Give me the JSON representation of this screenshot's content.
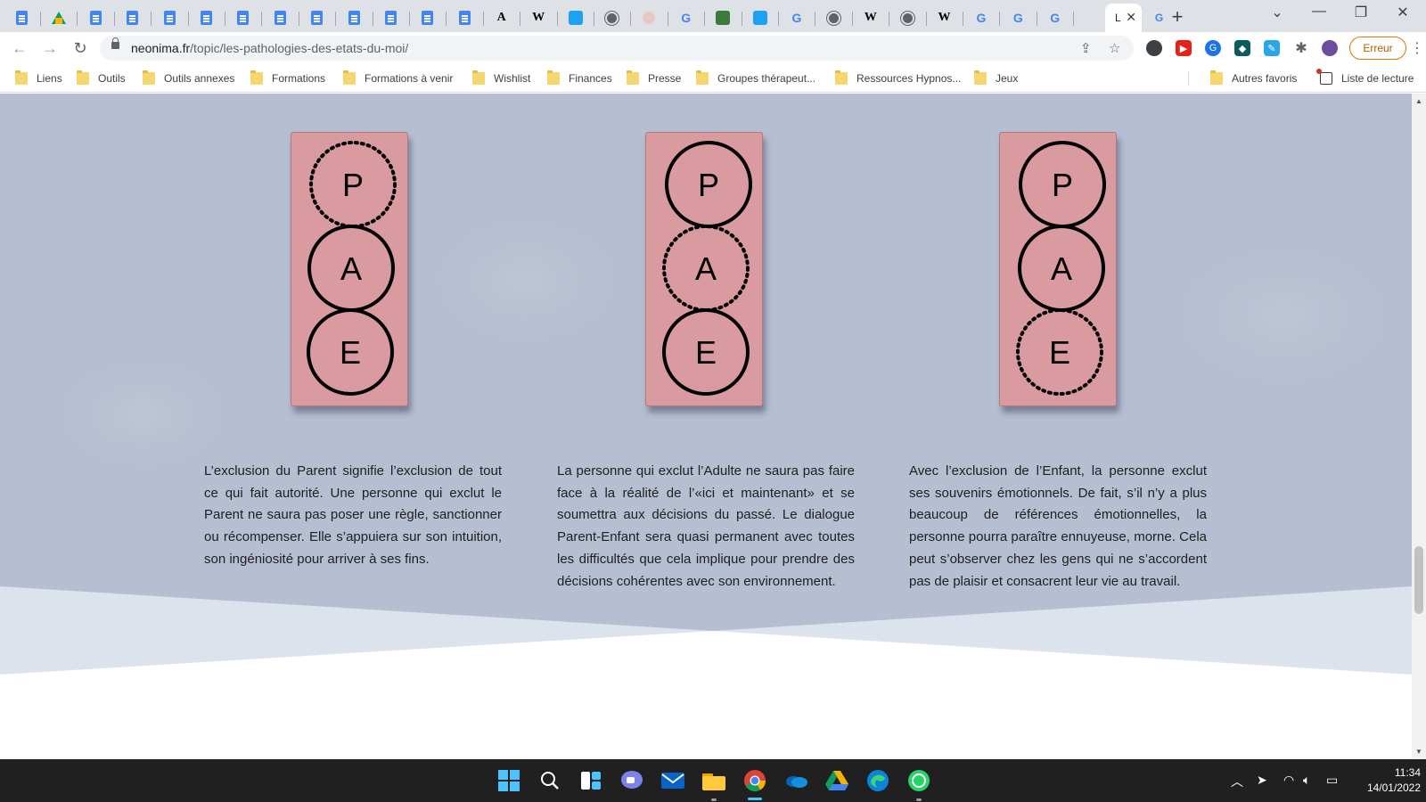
{
  "browser": {
    "url_domain": "neonima.fr",
    "url_path": "/topic/les-pathologies-des-etats-du-moi/",
    "active_tab_title": "L",
    "error_button_label": "Erreur",
    "tabs": [
      {
        "icon": "google-docs-icon"
      },
      {
        "icon": "google-drive-icon"
      },
      {
        "icon": "google-docs-icon"
      },
      {
        "icon": "google-docs-icon"
      },
      {
        "icon": "google-docs-icon"
      },
      {
        "icon": "google-docs-icon"
      },
      {
        "icon": "google-docs-icon"
      },
      {
        "icon": "google-docs-icon"
      },
      {
        "icon": "google-docs-icon"
      },
      {
        "icon": "google-docs-icon"
      },
      {
        "icon": "google-docs-icon"
      },
      {
        "icon": "google-docs-icon"
      },
      {
        "icon": "google-docs-icon"
      },
      {
        "icon": "translate-icon"
      },
      {
        "icon": "wikipedia-icon"
      },
      {
        "icon": "bird-icon"
      },
      {
        "icon": "globe-icon"
      },
      {
        "icon": "pale-circle-icon"
      },
      {
        "icon": "google-icon"
      },
      {
        "icon": "misc-site-icon"
      },
      {
        "icon": "bird-icon"
      },
      {
        "icon": "google-icon"
      },
      {
        "icon": "globe-icon"
      },
      {
        "icon": "wikipedia-icon"
      },
      {
        "icon": "globe-icon"
      },
      {
        "icon": "wikipedia-icon"
      },
      {
        "icon": "google-icon"
      },
      {
        "icon": "google-icon"
      },
      {
        "icon": "google-icon"
      }
    ]
  },
  "bookmarks": [
    "Liens",
    "Outils",
    "Outils annexes",
    "Formations",
    "Formations à venir",
    "Wishlist",
    "Finances",
    "Presse",
    "Groupes thérapeut...",
    "Ressources Hypnos...",
    "Jeux"
  ],
  "bookmarks_other": "Autres favoris",
  "reading_list": "Liste de lecture",
  "diagrams": [
    {
      "circles": [
        {
          "letter": "P",
          "style": "dotted"
        },
        {
          "letter": "A",
          "style": "solid"
        },
        {
          "letter": "E",
          "style": "solid"
        }
      ]
    },
    {
      "circles": [
        {
          "letter": "P",
          "style": "solid"
        },
        {
          "letter": "A",
          "style": "dotted"
        },
        {
          "letter": "E",
          "style": "solid"
        }
      ]
    },
    {
      "circles": [
        {
          "letter": "P",
          "style": "solid"
        },
        {
          "letter": "A",
          "style": "solid"
        },
        {
          "letter": "E",
          "style": "dotted"
        }
      ]
    }
  ],
  "descriptions": [
    "L’exclusion du Parent signifie l’exclusion de tout ce qui fait autorité. Une personne qui exclut le Parent ne saura pas poser une règle, sanctionner ou récompenser. Elle s’appuiera sur son intuition, son ingéniosité pour arriver à ses fins.",
    "La personne qui exclut l’Adulte ne saura pas faire face à la réalité de l’«ici et maintenant» et se soumettra aux décisions du passé. Le dialogue Parent-Enfant sera quasi permanent avec toutes les difficultés que cela implique pour prendre des décisions cohérentes avec son environnement.",
    "Avec l’exclusion de l’Enfant, la personne exclut ses souvenirs émotionnels. De fait, s’il n’y a plus beaucoup de références émotionnelles, la personne pourra paraître ennuyeuse, morne. Cela peut s’observer chez les gens qui ne s’accordent pas de plaisir et consacrent leur vie au travail."
  ],
  "colors": {
    "page_background": "#b5bfd1",
    "card_fill": "#d99aa0",
    "lower_band": "#dde3ed",
    "taskbar": "#202020"
  },
  "taskbar": {
    "apps": [
      "start-icon",
      "search-icon",
      "widgets-icon",
      "chat-icon",
      "mail-icon",
      "file-explorer-icon",
      "chrome-icon",
      "onedrive-icon",
      "google-drive-icon",
      "edge-icon",
      "whatsapp-icon"
    ],
    "time": "11:34",
    "date": "14/01/2022"
  }
}
